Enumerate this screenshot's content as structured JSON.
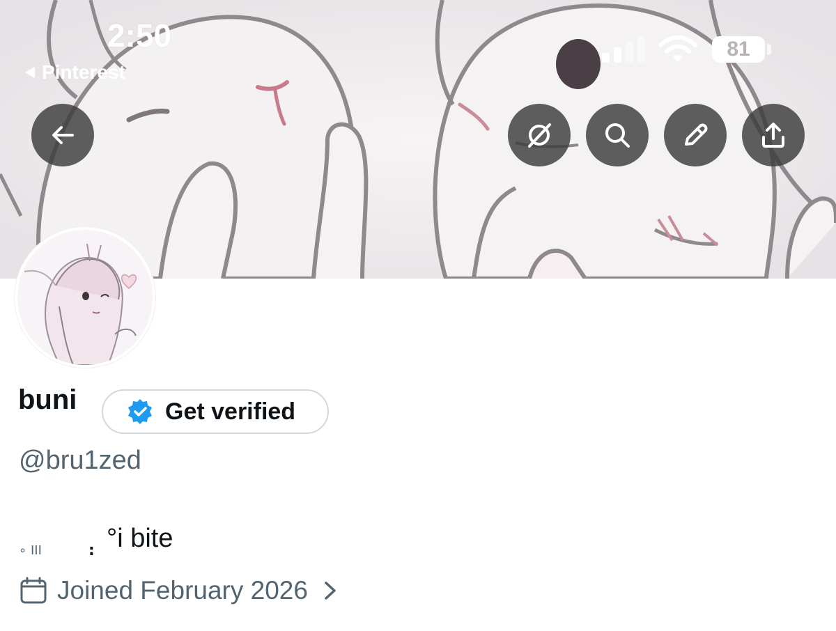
{
  "status_bar": {
    "time": "2:50",
    "back_app_label": "Pinterest",
    "battery_level": "81",
    "signal_bars_active": 2,
    "signal_bars_total": 4
  },
  "toolbar": {
    "back_icon": "arrow-left-icon",
    "actions": [
      {
        "name": "grok-icon"
      },
      {
        "name": "search-icon"
      },
      {
        "name": "edit-icon"
      },
      {
        "name": "share-icon"
      }
    ]
  },
  "profile": {
    "display_name": "buni",
    "verify_label": "Get verified",
    "handle": "@bru1zed",
    "bio_dot": "∘ ΙΙΙ",
    "bio_mark": ":",
    "bio_text": "°i bite",
    "joined": "Joined February 2026"
  },
  "colors": {
    "accent_verified": "#1d9bf0",
    "secondary_text": "#536471",
    "primary_text": "#0f1419",
    "button_overlay": "#3c3c3c"
  }
}
